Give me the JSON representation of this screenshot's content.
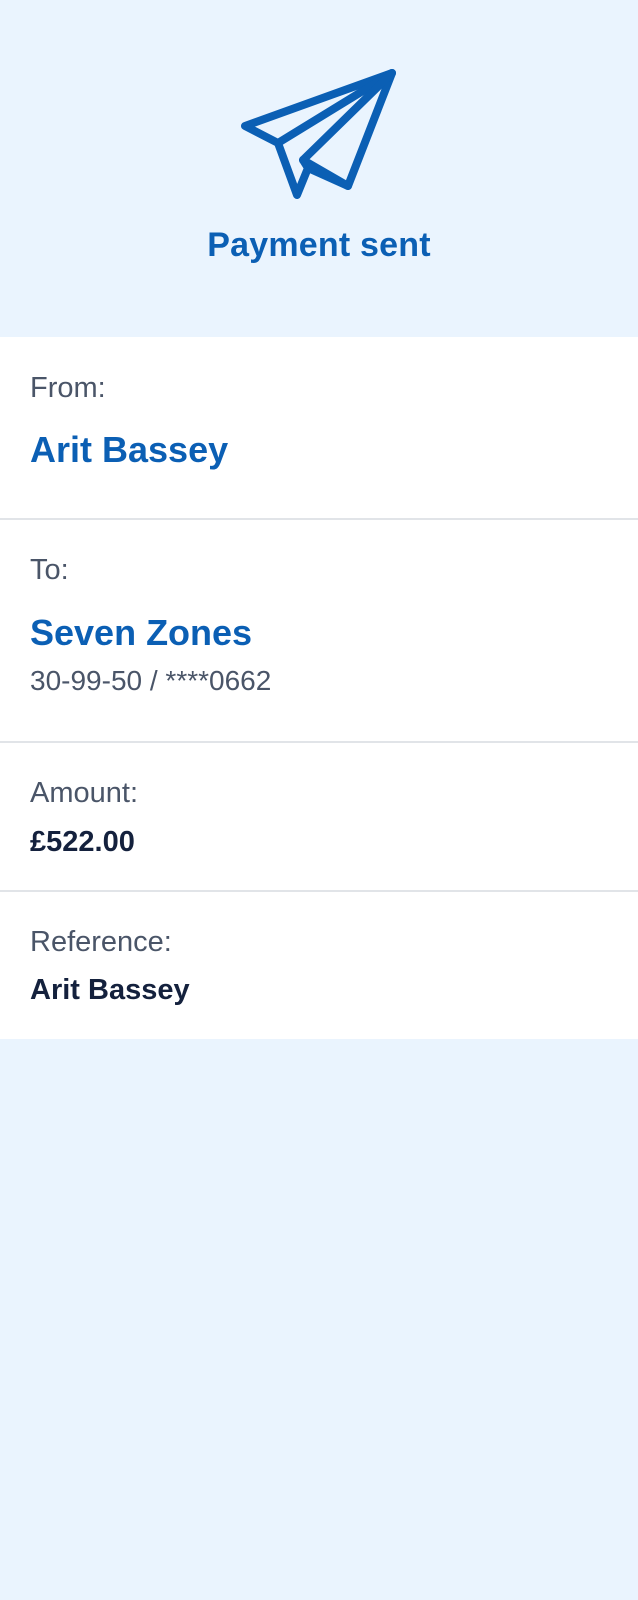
{
  "header": {
    "status_icon": "paper-plane-icon",
    "title": "Payment sent"
  },
  "from": {
    "label": "From:",
    "name": "Arit Bassey"
  },
  "to": {
    "label": "To:",
    "name": "Seven Zones",
    "account": "30-99-50 / ****0662"
  },
  "amount": {
    "label": "Amount:",
    "value": "£522.00"
  },
  "reference": {
    "label": "Reference:",
    "value": "Arit Bassey"
  },
  "colors": {
    "brand": "#0b5fb4",
    "background": "#eaf4fe",
    "text_dark": "#14213d",
    "text_muted": "#4a5568"
  }
}
